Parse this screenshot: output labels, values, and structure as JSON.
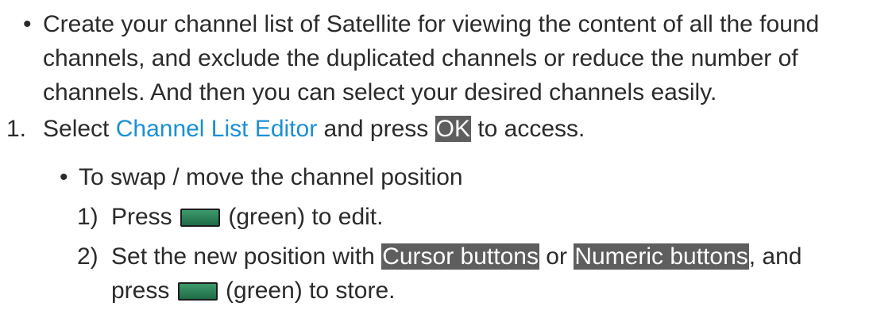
{
  "intro": {
    "bullet": "•",
    "text": "Create your channel list of Satellite for viewing the content of all the found channels, and exclude the duplicated channels or reduce the number of channels. And then you can select your desired channels easily."
  },
  "step1": {
    "number": "1.",
    "select": "Select ",
    "menu_link": "Channel List Editor",
    "and_press": " and press ",
    "ok_key": "OK",
    "to_access": " to access."
  },
  "swap": {
    "bullet": "•",
    "text": "To swap / move the channel position"
  },
  "substep1": {
    "number": "1)",
    "press": "Press ",
    "key_icon": "green-key-icon",
    "after": " (green) to edit."
  },
  "substep2": {
    "number": "2)",
    "set_text": "Set the new position with ",
    "cursor_key": "Cursor buttons",
    "or_text": " or ",
    "numeric_key": "Numeric buttons",
    "and_press": ", and press ",
    "key_icon": "green-key-icon",
    "after": " (green) to store."
  },
  "colors": {
    "link": "#1a8fd6",
    "key_background": "#5e5e5e",
    "green_button": "#2e8259",
    "text": "#2b2b2b"
  }
}
